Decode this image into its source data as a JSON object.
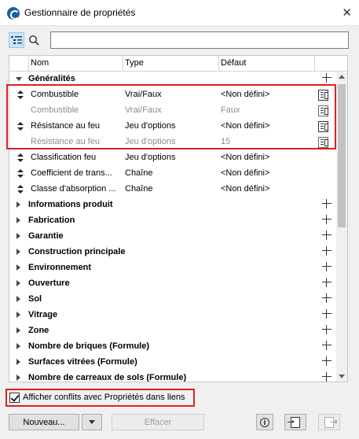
{
  "window": {
    "title": "Gestionnaire de propriétés",
    "close_label": "✕"
  },
  "search": {
    "value": "",
    "placeholder": ""
  },
  "columns": {
    "name": "Nom",
    "type": "Type",
    "default": "Défaut"
  },
  "rows": [
    {
      "kind": "group-open",
      "name": "Généralités",
      "type": "",
      "default": "",
      "trailing": "plus"
    },
    {
      "kind": "prop",
      "name": "Combustible",
      "type": "Vrai/Faux",
      "default": "<Non défini>",
      "trailing": "doc",
      "handle": true
    },
    {
      "kind": "prop-grey",
      "name": "Combustible",
      "type": "Vrai/Faux",
      "default": "Faux",
      "trailing": "doc-link",
      "handle": false
    },
    {
      "kind": "prop",
      "name": "Résistance au feu",
      "type": "Jeu d'options",
      "default": "<Non défini>",
      "trailing": "doc",
      "handle": true
    },
    {
      "kind": "prop-grey",
      "name": "Résistance au feu",
      "type": "Jeu d'options",
      "default": "15",
      "trailing": "doc-link",
      "handle": false
    },
    {
      "kind": "prop",
      "name": "Classification feu",
      "type": "Jeu d'options",
      "default": "<Non défini>",
      "trailing": "",
      "handle": true
    },
    {
      "kind": "prop",
      "name": "Coefficient de trans...",
      "type": "Chaîne",
      "default": "<Non défini>",
      "trailing": "",
      "handle": true
    },
    {
      "kind": "prop",
      "name": "Classe d'absorption ...",
      "type": "Chaîne",
      "default": "<Non défini>",
      "trailing": "",
      "handle": true
    },
    {
      "kind": "group",
      "name": "Informations produit",
      "trailing": "plus"
    },
    {
      "kind": "group",
      "name": "Fabrication",
      "trailing": "plus"
    },
    {
      "kind": "group",
      "name": "Garantie",
      "trailing": "plus"
    },
    {
      "kind": "group",
      "name": "Construction principale",
      "trailing": "plus"
    },
    {
      "kind": "group",
      "name": "Environnement",
      "trailing": "plus"
    },
    {
      "kind": "group",
      "name": "Ouverture",
      "trailing": "plus"
    },
    {
      "kind": "group",
      "name": "Sol",
      "trailing": "plus"
    },
    {
      "kind": "group",
      "name": "Vitrage",
      "trailing": "plus"
    },
    {
      "kind": "group",
      "name": "Zone",
      "trailing": "plus"
    },
    {
      "kind": "group",
      "name": "Nombre de briques (Formule)",
      "trailing": "plus"
    },
    {
      "kind": "group",
      "name": "Surfaces vitrées (Formule)",
      "trailing": "plus"
    },
    {
      "kind": "group",
      "name": "Nombre de carreaux de sols (Formule)",
      "trailing": "plus"
    }
  ],
  "conflicts_checkbox": {
    "label": "Afficher conflits avec Propriétés dans liens",
    "checked": true
  },
  "buttons": {
    "new_label": "Nouveau...",
    "delete_label": "Effacer"
  },
  "colors": {
    "highlight": "#e0201f",
    "selected_tool": "#cce4f7"
  }
}
